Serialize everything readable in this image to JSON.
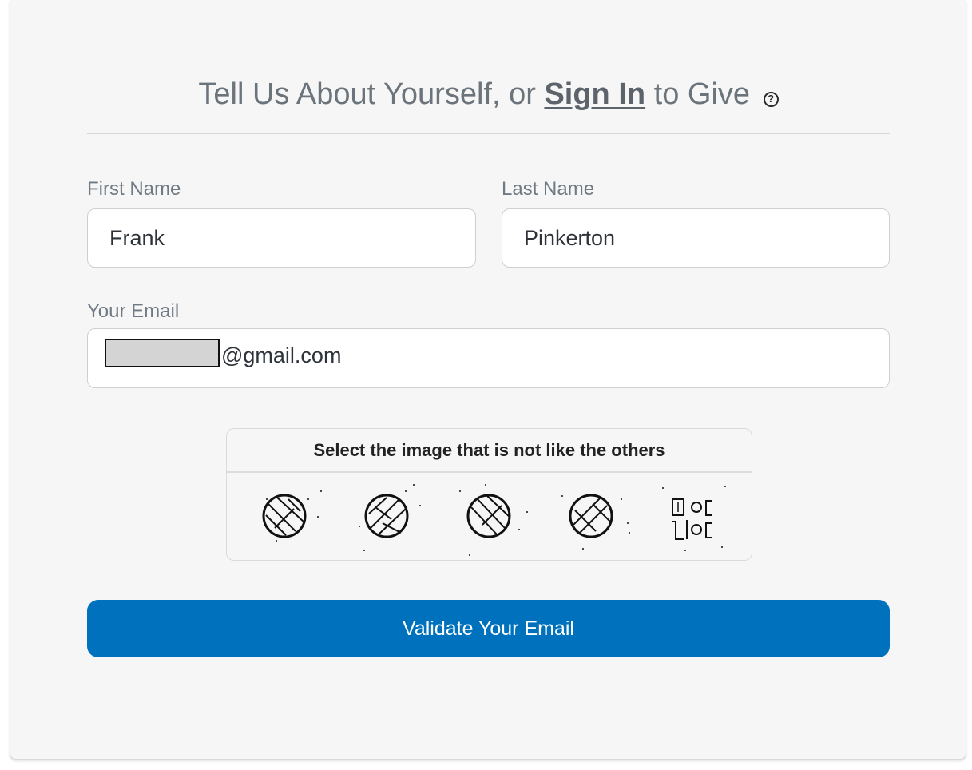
{
  "header": {
    "prefix": "Tell Us About Yourself, or ",
    "sign_in_link": "Sign In",
    "suffix": " to Give ",
    "help_icon": "question-circle-icon",
    "help_glyph": "?"
  },
  "form": {
    "first_name": {
      "label": "First Name",
      "value": "Frank"
    },
    "last_name": {
      "label": "Last Name",
      "value": "Pinkerton"
    },
    "email": {
      "label": "Your Email",
      "visible_value": "@gmail.com",
      "redacted": true
    }
  },
  "captcha": {
    "prompt": "Select the image that is not like the others",
    "options": [
      {
        "icon": "volleyball-icon"
      },
      {
        "icon": "volleyball-icon"
      },
      {
        "icon": "volleyball-icon"
      },
      {
        "icon": "volleyball-icon"
      },
      {
        "icon": "toggle-switches-icon"
      }
    ]
  },
  "submit": {
    "label": "Validate Your Email"
  },
  "colors": {
    "card_background": "#f6f6f6",
    "primary_button": "#0071bc",
    "heading_text": "#6b737b",
    "label_text": "#707a84"
  }
}
